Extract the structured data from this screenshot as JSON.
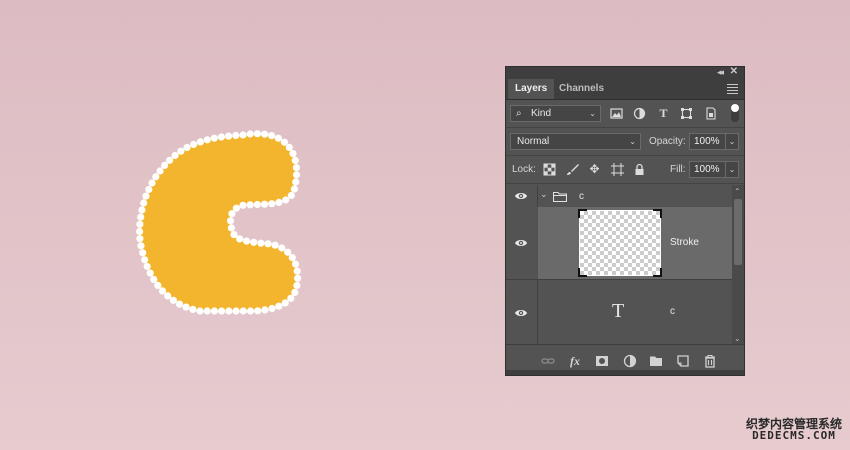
{
  "canvas": {
    "background": "#e0c2c7",
    "letter_fill": "#f2b52d",
    "bead_color": "#ffffff"
  },
  "panel": {
    "tabs": [
      {
        "label": "Layers",
        "active": true
      },
      {
        "label": "Channels",
        "active": false
      }
    ],
    "filter": {
      "label": "Kind"
    },
    "blend_mode": "Normal",
    "opacity_label": "Opacity:",
    "opacity_value": "100%",
    "lock_label": "Lock:",
    "fill_label": "Fill:",
    "fill_value": "100%",
    "layers": [
      {
        "type": "group",
        "name": "c",
        "visible": true,
        "expanded": true
      },
      {
        "type": "normal",
        "name": "Stroke",
        "visible": true,
        "selected": true
      },
      {
        "type": "text",
        "name": "c",
        "visible": true
      }
    ]
  },
  "watermark": {
    "line1": "织梦内容管理系统",
    "line2": "DEDECMS.COM"
  }
}
